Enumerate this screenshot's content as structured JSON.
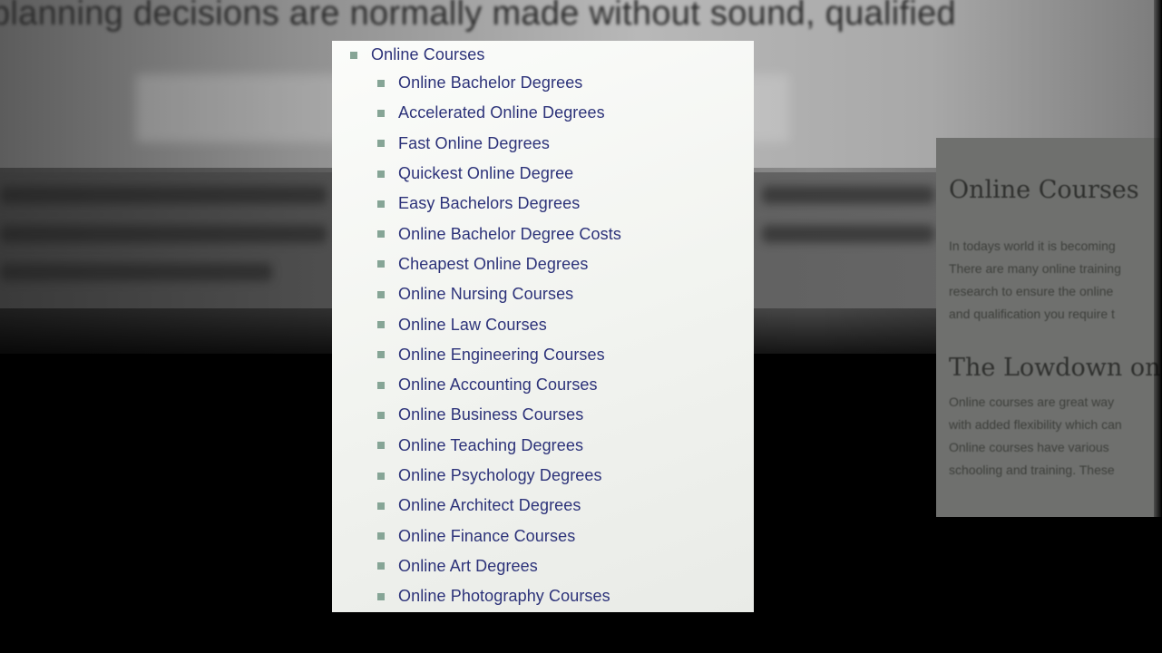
{
  "background": {
    "headline": "planning decisions are normally made without sound, qualified"
  },
  "sidebar": {
    "heading_1": "Online Courses",
    "paragraph_1": [
      "In todays world it is becoming",
      "There are many online training",
      "research to ensure the online",
      "and qualification you require t"
    ],
    "heading_2": "The Lowdown on",
    "paragraph_2": [
      "Online courses are great way",
      "with added flexibility which can",
      "Online courses have various",
      "schooling and training.  These"
    ]
  },
  "menu": {
    "root_label": "Online Courses",
    "items": [
      {
        "label": "Online Bachelor Degrees"
      },
      {
        "label": "Accelerated Online Degrees"
      },
      {
        "label": "Fast Online Degrees"
      },
      {
        "label": "Quickest Online Degree"
      },
      {
        "label": "Easy Bachelors Degrees"
      },
      {
        "label": "Online Bachelor Degree Costs"
      },
      {
        "label": "Cheapest Online Degrees"
      },
      {
        "label": "Online Nursing Courses"
      },
      {
        "label": "Online Law Courses"
      },
      {
        "label": "Online Engineering Courses"
      },
      {
        "label": "Online Accounting Courses"
      },
      {
        "label": "Online Business Courses"
      },
      {
        "label": "Online Teaching Degrees"
      },
      {
        "label": "Online Psychology Degrees"
      },
      {
        "label": "Online Architect Degrees"
      },
      {
        "label": "Online Finance Courses"
      },
      {
        "label": "Online Art Degrees"
      },
      {
        "label": "Online Photography Courses"
      }
    ]
  },
  "colors": {
    "link": "#2c3279",
    "bullet": "#86a596",
    "panel_bg": "#f3f5f1"
  }
}
